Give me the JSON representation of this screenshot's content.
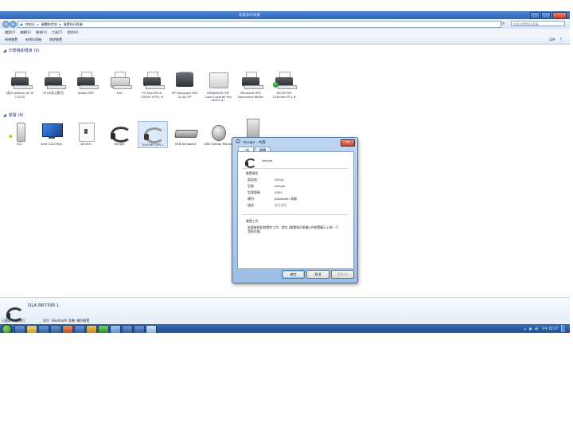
{
  "window": {
    "title": "裝置和印表機",
    "breadcrumb": [
      "控制台",
      "硬體和音效",
      "裝置和印表機"
    ],
    "search_placeholder": "搜尋 裝置和印表機"
  },
  "menu": [
    "檔案(F)",
    "編輯(E)",
    "檢視(V)",
    "工具(T)",
    "說明(H)"
  ],
  "commands": [
    "新增裝置",
    "新增印表機",
    "移除裝置"
  ],
  "groups": {
    "printers": {
      "header": "印表機和傳真 (9)",
      "items": [
        "(彩)FujiXerox AP-IV C3370",
        "3370(彩)(黑白)",
        "Adobe PDF",
        "Fax",
        "FX DocuPrint C5005 d PCL 6",
        "HP Designjet 500 42 by HP",
        "HPAA8249 (HP Color LaserJet Pro M451-4)",
        "Microsoft XPS Document Writer",
        "RICOH MP C2004ex PCL 6"
      ]
    },
    "devices": {
      "header": "裝置 (8)",
      "items": [
        "617",
        "Acer S220HQL",
        "Device",
        "dongle",
        "QLA BR7395 L",
        "USB Keyboard",
        "USB Optical Mouse",
        ""
      ]
    }
  },
  "details": {
    "name": "QLA BR7395 L",
    "category_label": "類別:",
    "category_value": "Bluetooth 耳機; 喇叭裝置"
  },
  "status_bar": "已選取 1 個項目",
  "taskbar": {
    "clock": "下午 02:37"
  },
  "dialog": {
    "title": "dongle - 內容",
    "tabs": [
      "一般",
      "硬體"
    ],
    "device_name": "dongle",
    "info_header": "裝置資訊",
    "info_rows": [
      {
        "label": "製造商:",
        "value": "EDGA"
      },
      {
        "label": "型號:",
        "value": "dongle"
      },
      {
        "label": "型號號碼:",
        "value": "0001"
      },
      {
        "label": "類別:",
        "value": "Bluetooth 耳機"
      },
      {
        "label": "描述:",
        "value": "無法使用"
      }
    ],
    "tasks_header": "裝置工作",
    "tasks_text": "若要檢視此裝置的工作，請在 [裝置和印表機] 的裝置圖示上按一下滑鼠右鍵。",
    "buttons": {
      "ok": "確定",
      "cancel": "取消",
      "apply": "套用(A)"
    }
  }
}
